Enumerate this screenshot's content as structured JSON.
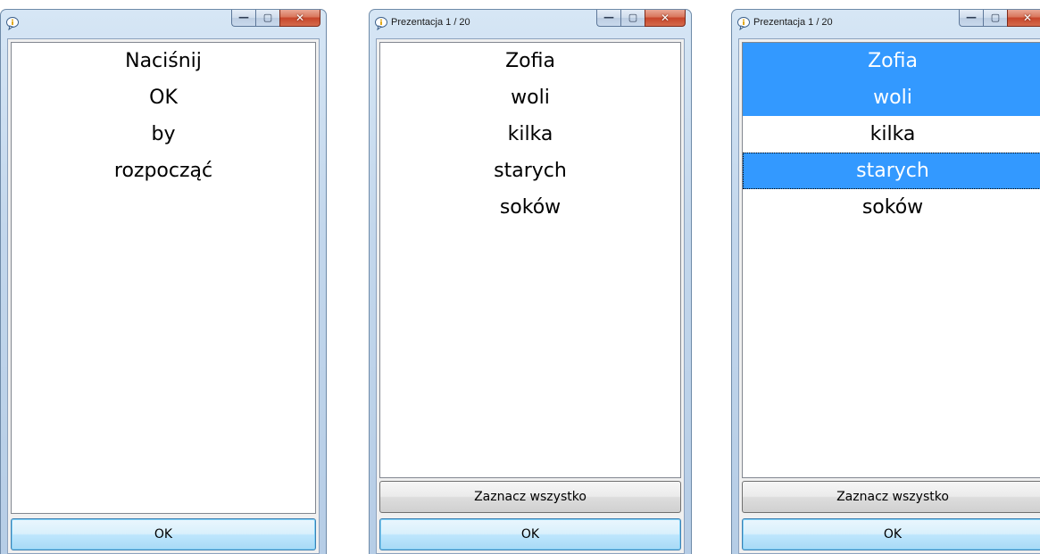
{
  "windows": [
    {
      "title": "",
      "items": [
        "Naciśnij",
        "OK",
        "by",
        "rozpocząć"
      ],
      "ok_label": "OK"
    },
    {
      "title": "Prezentacja 1 / 20",
      "items": [
        "Zofia",
        "woli",
        "kilka",
        "starych",
        "soków"
      ],
      "select_all_label": "Zaznacz wszystko",
      "ok_label": "OK"
    },
    {
      "title": "Prezentacja 1 / 20",
      "items": [
        "Zofia",
        "woli",
        "kilka",
        "starych",
        "soków"
      ],
      "selected_items": [
        "Zofia",
        "woli",
        "starych"
      ],
      "select_all_label": "Zaznacz wszystko",
      "ok_label": "OK"
    }
  ],
  "caption_glyphs": {
    "minimize": "—",
    "maximize": "▢",
    "close": "✕"
  },
  "colors": {
    "selection": "#3399ff",
    "titlebar": "#c3d7ec",
    "close_button": "#c7452a"
  },
  "icons": {
    "app": "info-balloon-icon"
  }
}
